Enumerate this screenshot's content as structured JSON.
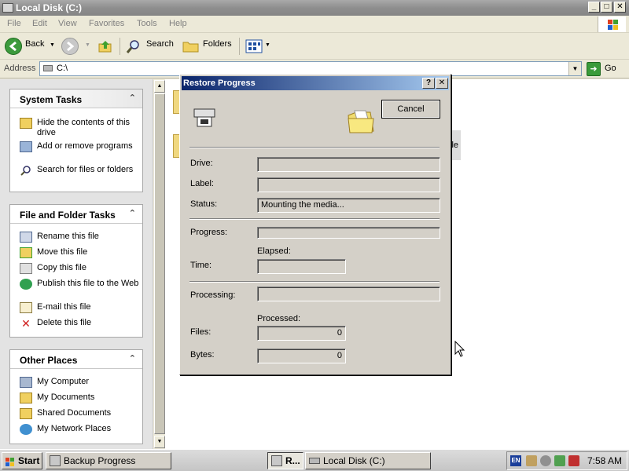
{
  "window": {
    "title": "Local Disk (C:)",
    "controls": {
      "minimize": "_",
      "maximize": "□",
      "close": "✕"
    }
  },
  "menubar": [
    "File",
    "Edit",
    "View",
    "Favorites",
    "Tools",
    "Help"
  ],
  "toolbar": {
    "back": "Back",
    "search": "Search",
    "folders": "Folders"
  },
  "address": {
    "label": "Address",
    "value": "C:\\",
    "go": "Go"
  },
  "tasks": {
    "system": {
      "title": "System Tasks",
      "items": [
        "Hide the contents of this drive",
        "Add or remove programs",
        "Search for files or folders"
      ]
    },
    "file_folder": {
      "title": "File and Folder Tasks",
      "items": [
        "Rename this file",
        "Move this file",
        "Copy this file",
        "Publish this file to the Web",
        "E-mail this file",
        "Delete this file"
      ]
    },
    "other": {
      "title": "Other Places",
      "items": [
        "My Computer",
        "My Documents",
        "Shared Documents",
        "My Network Places"
      ]
    }
  },
  "background_text": {
    "file_fragment": "ile"
  },
  "dialog": {
    "title": "Restore Progress",
    "help": "?",
    "close": "✕",
    "cancel": "Cancel",
    "labels": {
      "drive": "Drive:",
      "label": "Label:",
      "status": "Status:",
      "progress": "Progress:",
      "elapsed": "Elapsed:",
      "time": "Time:",
      "processing": "Processing:",
      "processed": "Processed:",
      "files": "Files:",
      "bytes": "Bytes:"
    },
    "values": {
      "drive": "",
      "label": "",
      "status": "Mounting the media...",
      "progress": 0,
      "time": "",
      "processing": "",
      "files": "0",
      "bytes": "0"
    }
  },
  "taskbar": {
    "start": "Start",
    "tasks": [
      {
        "label": "Backup Progress"
      },
      {
        "label": "R..."
      },
      {
        "label": "Local Disk (C:)"
      }
    ],
    "language": "EN",
    "clock": "7:58 AM"
  },
  "colors": {
    "dialog_title_start": "#0a246a",
    "dialog_title_end": "#a6caf0",
    "go_green": "#3a9b3a"
  }
}
